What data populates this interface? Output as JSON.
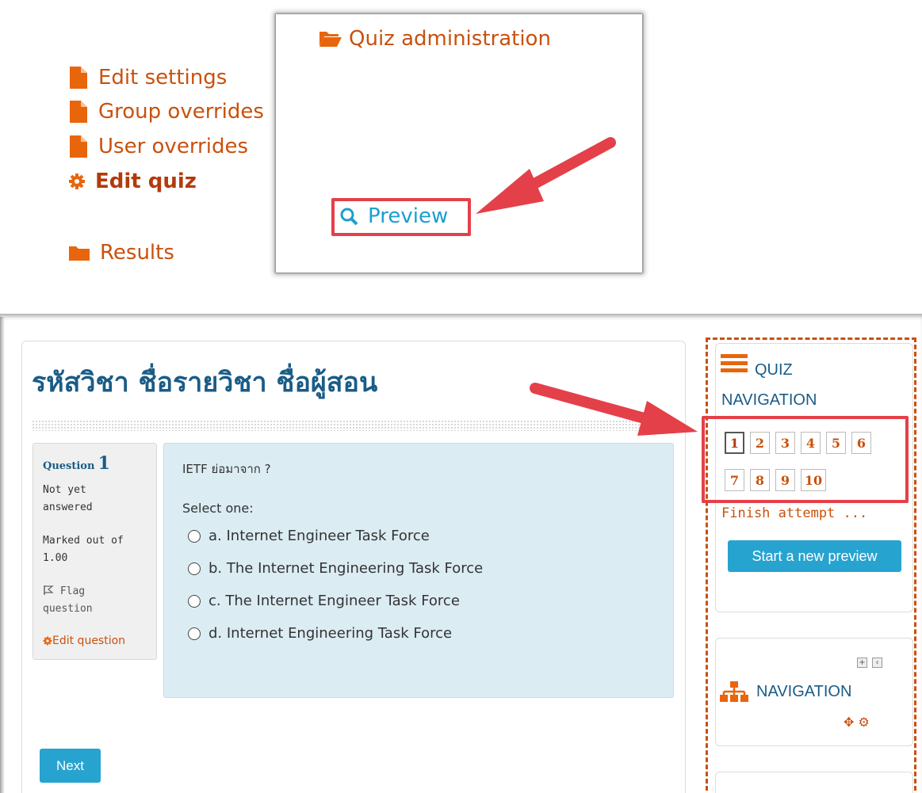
{
  "admin_menu": {
    "title": "Quiz administration",
    "items": [
      {
        "label": "Edit settings",
        "icon": "file-icon"
      },
      {
        "label": "Group overrides",
        "icon": "file-icon"
      },
      {
        "label": "User overrides",
        "icon": "file-icon"
      },
      {
        "label": "Edit quiz",
        "icon": "gear-icon"
      },
      {
        "label": "Preview",
        "icon": "search-icon"
      },
      {
        "label": "Results",
        "icon": "folder-icon"
      }
    ]
  },
  "quiz": {
    "page_title": "รหัสวิชา ชื่อรายวิชา ชื่อผู้สอน",
    "question_info": {
      "question_label": "Question",
      "question_number": "1",
      "status_line1": "Not yet",
      "status_line2": "answered",
      "marked_line1": "Marked out of",
      "marked_line2": "1.00",
      "flag_line1": "Flag",
      "flag_line2": "question",
      "edit_question": "Edit question"
    },
    "question_text": "IETF ย่อมาจาก ?",
    "select_prompt": "Select one:",
    "options": [
      "a. Internet Engineer Task Force",
      "b. The Internet Engineering Task Force",
      "c. The Internet Engineer Task Force",
      "d. Internet Engineering Task Force"
    ],
    "next_label": "Next"
  },
  "quiz_navigation": {
    "title_line1": "QUIZ",
    "title_line2": "NAVIGATION",
    "buttons": [
      "1",
      "2",
      "3",
      "4",
      "5",
      "6",
      "7",
      "8",
      "9",
      "10"
    ],
    "current": "1",
    "finish_label": "Finish attempt ...",
    "start_new_label": "Start a new preview"
  },
  "navigation_block": {
    "title": "NAVIGATION"
  },
  "colors": {
    "link_orange": "#c9510c",
    "heading_blue": "#1a5c86",
    "button_blue": "#27a3d0",
    "highlight_red": "#e4404a",
    "question_bg": "#dbecf3"
  }
}
